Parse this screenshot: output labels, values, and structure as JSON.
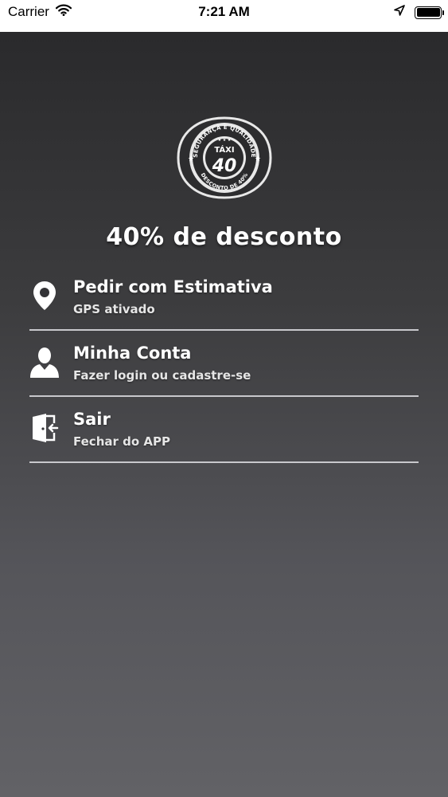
{
  "status_bar": {
    "carrier": "Carrier",
    "time": "7:21 AM",
    "battery_level": 1.0
  },
  "logo": {
    "top_text": "SEGURANÇA E QUALIDADE",
    "brand": "TÁXI",
    "number": "40",
    "bottom_text": "DESCONTO DE 40%"
  },
  "headline": "40% de desconto",
  "menu": {
    "items": [
      {
        "title": "Pedir com Estimativa",
        "subtitle": "GPS ativado",
        "icon": "location-pin-icon"
      },
      {
        "title": "Minha Conta",
        "subtitle": "Fazer login ou cadastre-se",
        "icon": "user-icon"
      },
      {
        "title": "Sair",
        "subtitle": "Fechar do APP",
        "icon": "exit-door-icon"
      }
    ]
  },
  "colors": {
    "background_top": "#2a2a2c",
    "background_bottom": "#626266",
    "text": "#ffffff",
    "divider": "#c8c8cc"
  }
}
